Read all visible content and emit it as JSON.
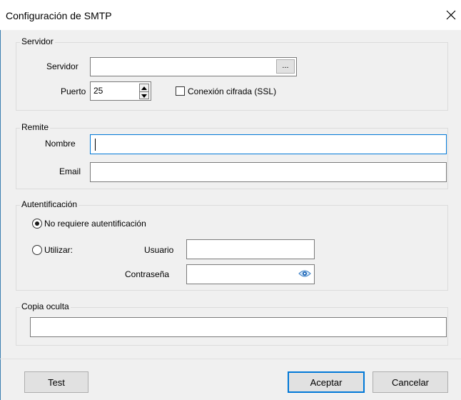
{
  "window": {
    "title": "Configuración de SMTP"
  },
  "servidor_group": {
    "legend": "Servidor",
    "servidor_label": "Servidor",
    "servidor_value": "",
    "browse_label": "...",
    "puerto_label": "Puerto",
    "puerto_value": "25",
    "ssl_label": "Conexión cifrada (SSL)",
    "ssl_checked": false
  },
  "remite_group": {
    "legend": "Remite",
    "nombre_label": "Nombre",
    "nombre_value": "",
    "email_label": "Email",
    "email_value": ""
  },
  "auth_group": {
    "legend": "Autentificación",
    "option_none": "No requiere autentificación",
    "option_use": "Utilizar:",
    "selected": "none",
    "usuario_label": "Usuario",
    "usuario_value": "",
    "password_label": "Contraseña",
    "password_value": ""
  },
  "bcc_group": {
    "legend": "Copia oculta",
    "value": ""
  },
  "buttons": {
    "test": "Test",
    "ok": "Aceptar",
    "cancel": "Cancelar"
  },
  "icons": {
    "close": "close-icon",
    "spin_up": "arrow-up-icon",
    "spin_down": "arrow-down-icon",
    "eye": "eye-icon"
  },
  "colors": {
    "accent": "#0078d7",
    "window_bg": "#f0f0f0"
  }
}
